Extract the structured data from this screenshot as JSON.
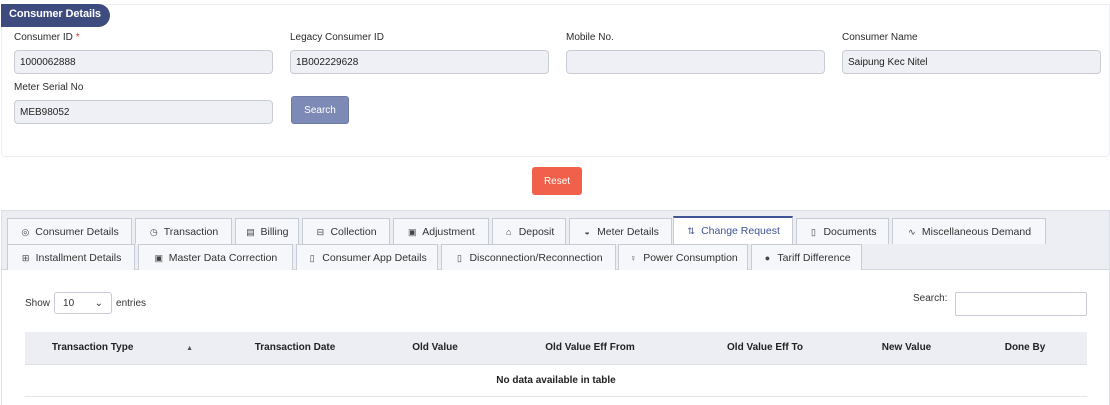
{
  "section": {
    "title": "Consumer Details"
  },
  "fields": {
    "consumer_id": {
      "label": "Consumer ID",
      "required_mark": "*",
      "value": "1000062888"
    },
    "legacy_consumer_id": {
      "label": "Legacy Consumer ID",
      "value": "1B002229628"
    },
    "mobile_no": {
      "label": "Mobile No.",
      "value": ""
    },
    "consumer_name": {
      "label": "Consumer Name",
      "value": "Saipung Kec Nitel"
    },
    "meter_serial_no": {
      "label": "Meter Serial No",
      "value": "MEB98052"
    }
  },
  "buttons": {
    "search": "Search",
    "reset": "Reset"
  },
  "tabs": [
    {
      "label": "Consumer Details",
      "icon": "target-icon"
    },
    {
      "label": "Transaction",
      "icon": "clock-icon"
    },
    {
      "label": "Billing",
      "icon": "bar-chart-icon"
    },
    {
      "label": "Collection",
      "icon": "list-box-icon"
    },
    {
      "label": "Adjustment",
      "icon": "image-box-icon"
    },
    {
      "label": "Deposit",
      "icon": "bank-icon"
    },
    {
      "label": "Meter Details",
      "icon": "gauge-icon"
    },
    {
      "label": "Change Request",
      "icon": "pull-request-icon",
      "active": true
    },
    {
      "label": "Documents",
      "icon": "document-icon"
    },
    {
      "label": "Miscellaneous Demand",
      "icon": "pulse-icon"
    },
    {
      "label": "Installment Details",
      "icon": "calculator-icon"
    },
    {
      "label": "Master Data Correction",
      "icon": "id-card-icon"
    },
    {
      "label": "Consumer App Details",
      "icon": "mobile-icon"
    },
    {
      "label": "Disconnection/Reconnection",
      "icon": "mobile-icon"
    },
    {
      "label": "Power Consumption",
      "icon": "bulb-icon"
    },
    {
      "label": "Tariff Difference",
      "icon": "dot-icon"
    }
  ],
  "table": {
    "show_label": "Show",
    "entries_value": "10",
    "entries_label": "entries",
    "search_label": "Search:",
    "columns": [
      "Transaction Type",
      "Transaction Date",
      "Old Value",
      "Old Value Eff From",
      "Old Value Eff To",
      "New Value",
      "Done By"
    ],
    "empty_message": "No data available in table"
  },
  "colors": {
    "brand": "#3e4b7e",
    "active_tab": "#3f5396",
    "search_button": "#7d8ab6",
    "reset_button": "#f0604a"
  }
}
